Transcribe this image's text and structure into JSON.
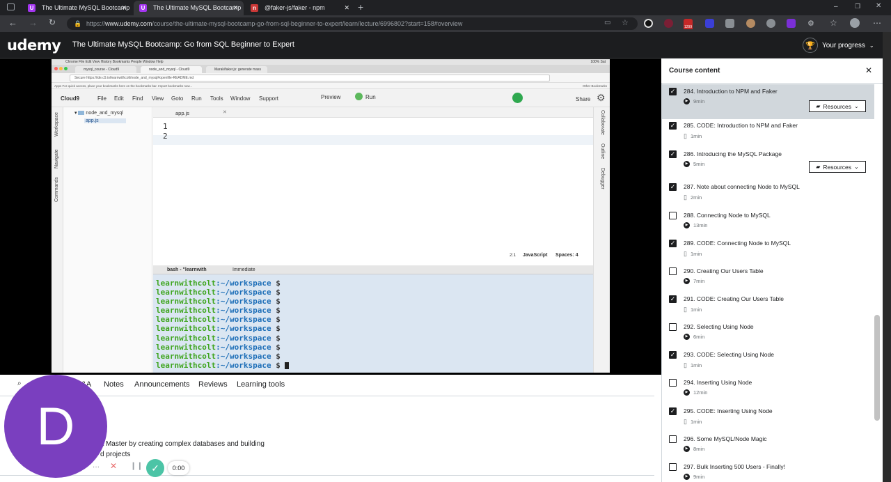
{
  "browser": {
    "tabs": [
      {
        "title": "The Ultimate MySQL Bootcamp",
        "active": false,
        "color": "#a435f0",
        "glyph": "U"
      },
      {
        "title": "The Ultimate MySQL Bootcamp",
        "active": true,
        "color": "#a435f0",
        "glyph": "U"
      },
      {
        "title": "@faker-js/faker - npm",
        "active": false,
        "color": "#cb3837",
        "glyph": "n"
      }
    ],
    "url_prefix": "https://",
    "url_host": "www.udemy.com",
    "url_path": "/course/the-ultimate-mysql-bootcamp-go-from-sql-beginner-to-expert/learn/lecture/6996802?start=158#overview",
    "badge": "1299"
  },
  "header": {
    "logo": "udemy",
    "course_title": "The Ultimate MySQL Bootcamp: Go from SQL Beginner to Expert",
    "progress_label": "Your progress"
  },
  "video": {
    "mac_menu": "Chrome   File   Edit   View   History   Bookmarks   People   Window   Help",
    "mac_status": "100%   Sat",
    "mac_tabs": [
      "mysql_course - Cloud9",
      "node_and_mysql - Cloud9",
      "Marak/faker.js: generate mass"
    ],
    "mac_url": "Secure   https://ide.c9.io/learnwithcolt/node_and_mysql#openfile-README.md",
    "bookmarks": "Apps   For quick access, place your bookmarks here on the bookmarks bar.  Import bookmarks now...",
    "other_bookmarks": "Other Bookmarks",
    "c9_menu": [
      "Cloud9",
      "File",
      "Edit",
      "Find",
      "View",
      "Goto",
      "Run",
      "Tools",
      "Window",
      "Support"
    ],
    "preview": "Preview",
    "run": "Run",
    "share": "Share",
    "folder": "node_and_mysql",
    "file": "app.js",
    "editor_tab": "app.js",
    "line_numbers": [
      "1",
      "2"
    ],
    "status": {
      "pos": "2:1",
      "lang": "JavaScript",
      "spaces": "Spaces: 4"
    },
    "left_panels": [
      "Workspace",
      "Navigate",
      "Commands"
    ],
    "right_panels": [
      "Collaborate",
      "Outline",
      "Debugger"
    ],
    "term_tabs": [
      "bash - \"learnwith",
      "Immediate"
    ],
    "prompt_user": "learnwithcolt",
    "prompt_path": ":~/workspace",
    "prompt_dollar": " $",
    "prompt_count": 10
  },
  "lecture_tabs": [
    "Q&A",
    "Notes",
    "Announcements",
    "Reviews",
    "Learning tools"
  ],
  "overview_text": [
    "L Master by creating complex databases and building",
    "d projects"
  ],
  "avatar_letter": "D",
  "controls": {
    "timer": "0:00"
  },
  "sidebar": {
    "title": "Course content",
    "items": [
      {
        "title": "284. Introduction to NPM and Faker",
        "dur": "9min",
        "type": "video",
        "done": true,
        "resources": true,
        "active": true
      },
      {
        "title": "285. CODE: Introduction to NPM and Faker",
        "dur": "1min",
        "type": "file",
        "done": true,
        "resources": false
      },
      {
        "title": "286. Introducing the MySQL Package",
        "dur": "5min",
        "type": "video",
        "done": true,
        "resources": true
      },
      {
        "title": "287. Note about connecting Node to MySQL",
        "dur": "2min",
        "type": "file",
        "done": true,
        "resources": false
      },
      {
        "title": "288. Connecting Node to MySQL",
        "dur": "13min",
        "type": "video",
        "done": false,
        "resources": false
      },
      {
        "title": "289. CODE: Connecting Node to MySQL",
        "dur": "1min",
        "type": "file",
        "done": true,
        "resources": false
      },
      {
        "title": "290. Creating Our Users Table",
        "dur": "7min",
        "type": "video",
        "done": false,
        "resources": false
      },
      {
        "title": "291. CODE: Creating Our Users Table",
        "dur": "1min",
        "type": "file",
        "done": true,
        "resources": false
      },
      {
        "title": "292. Selecting Using Node",
        "dur": "6min",
        "type": "video",
        "done": false,
        "resources": false
      },
      {
        "title": "293. CODE: Selecting Using Node",
        "dur": "1min",
        "type": "file",
        "done": true,
        "resources": false
      },
      {
        "title": "294. Inserting Using Node",
        "dur": "12min",
        "type": "video",
        "done": false,
        "resources": false
      },
      {
        "title": "295. CODE: Inserting Using Node",
        "dur": "1min",
        "type": "file",
        "done": true,
        "resources": false
      },
      {
        "title": "296. Some MySQL/Node Magic",
        "dur": "8min",
        "type": "video",
        "done": false,
        "resources": false
      },
      {
        "title": "297. Bulk Inserting 500 Users - Finally!",
        "dur": "9min",
        "type": "video",
        "done": false,
        "resources": false
      }
    ],
    "resources_label": "Resources"
  }
}
